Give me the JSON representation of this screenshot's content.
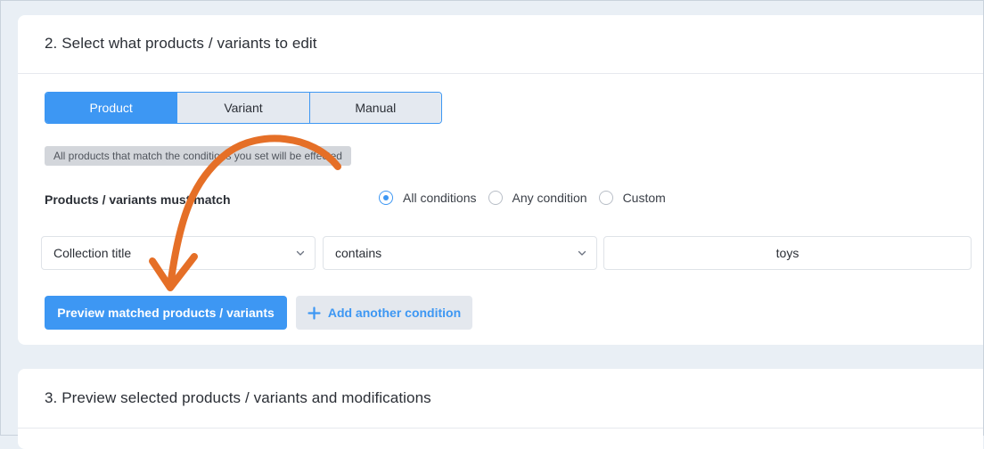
{
  "section2": {
    "title": "2. Select what products / variants to edit",
    "tabs": [
      {
        "label": "Product",
        "active": true
      },
      {
        "label": "Variant",
        "active": false
      },
      {
        "label": "Manual",
        "active": false
      }
    ],
    "info_tag": "All products that match the conditions you set will be effected",
    "match_label": "Products / variants must match",
    "radios": [
      {
        "label": "All conditions",
        "checked": true
      },
      {
        "label": "Any condition",
        "checked": false
      },
      {
        "label": "Custom",
        "checked": false
      }
    ],
    "condition": {
      "field": "Collection title",
      "operator": "contains",
      "value": "toys"
    },
    "preview_button": "Preview matched products / variants",
    "add_condition_button": "Add another condition"
  },
  "section3": {
    "title": "3. Preview selected products / variants and modifications"
  },
  "icons": {
    "select_chevron": "chevron-down-icon",
    "add": "plus-icon",
    "annotation": "curved-arrow-icon"
  },
  "colors": {
    "accent": "#3d97f3",
    "annotation_arrow": "#e56f27",
    "background": "#e9eff5"
  }
}
